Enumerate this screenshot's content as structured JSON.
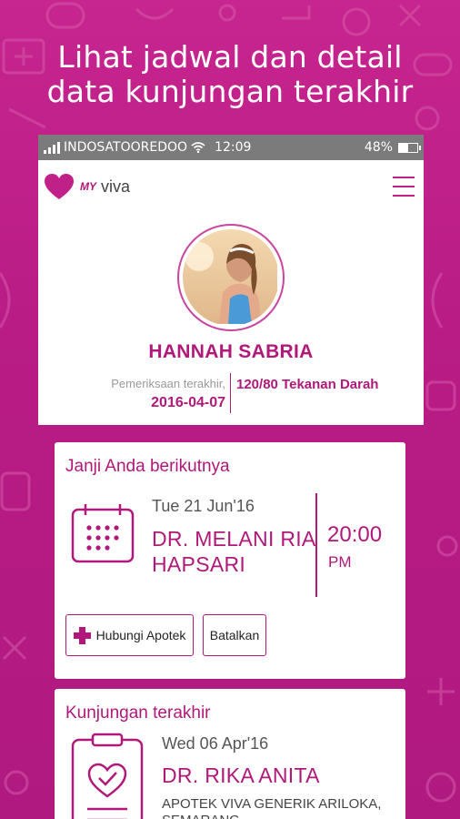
{
  "promo": {
    "line1": "Lihat jadwal dan detail",
    "line2": "data kunjungan terakhir"
  },
  "status_bar": {
    "carrier": "INDOSATOOREDOO",
    "time": "12:09",
    "battery": "48%",
    "battery_level": 0.48
  },
  "app": {
    "logo_my": "MY",
    "logo_viva": "viva"
  },
  "profile": {
    "name": "HANNAH SABRIA",
    "last_exam_label": "Pemeriksaan terakhir,",
    "last_exam_date": "2016-04-07",
    "blood_pressure": "120/80 Tekanan Darah"
  },
  "next_appointment": {
    "title": "Janji Anda berikutnya",
    "date": "Tue 21 Jun'16",
    "doctor": "DR. MELANI RIA HAPSARI",
    "time": "20:00",
    "ampm": "PM",
    "call_button": "Hubungi Apotek",
    "cancel_button": "Batalkan"
  },
  "last_visit": {
    "title": "Kunjungan terakhir",
    "date": "Wed 06 Apr'16",
    "doctor": "DR. RIKA ANITA",
    "place": "APOTEK VIVA GENERIK ARILOKA, SEMARANG"
  },
  "colors": {
    "brand": "#b0187a",
    "background": "#c02188",
    "status_bar": "#7b7b7b"
  }
}
